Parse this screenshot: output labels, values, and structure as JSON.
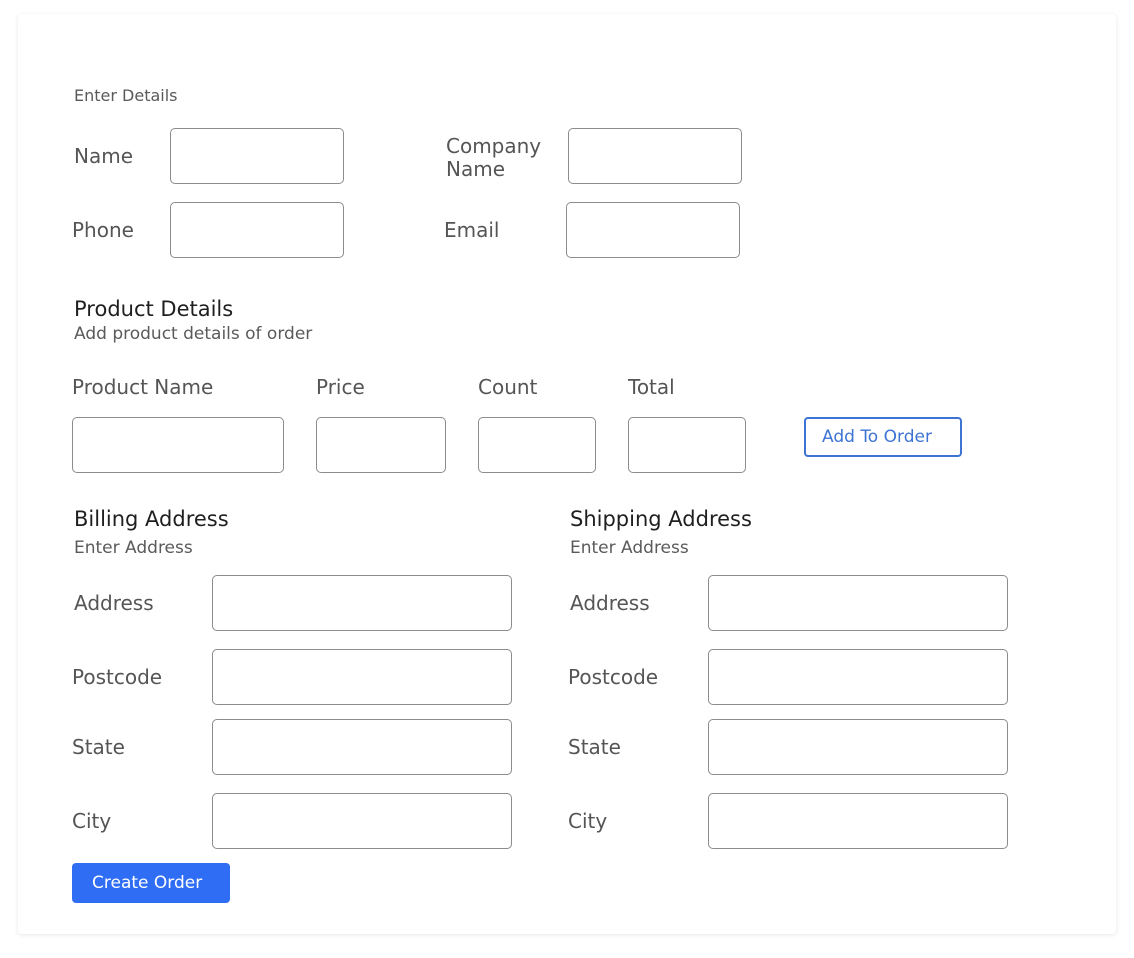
{
  "customer": {
    "heading": "Enter Details",
    "name_label": "Name",
    "company_label": "Company Name",
    "phone_label": "Phone",
    "email_label": "Email",
    "name_value": "",
    "company_value": "",
    "phone_value": "",
    "email_value": ""
  },
  "product": {
    "title": "Product Details",
    "subtitle": "Add product details of order",
    "name_label": "Product Name",
    "price_label": "Price",
    "count_label": "Count",
    "total_label": "Total",
    "add_button": "Add To Order"
  },
  "billing": {
    "title": "Billing Address",
    "subtitle": "Enter Address",
    "address_label": "Address",
    "postcode_label": "Postcode",
    "state_label": "State",
    "city_label": "City"
  },
  "shipping": {
    "title": "Shipping Address",
    "subtitle": "Enter Address",
    "address_label": "Address",
    "postcode_label": "Postcode",
    "state_label": "State",
    "city_label": "City"
  },
  "actions": {
    "create_button": "Create Order"
  },
  "colors": {
    "accent": "#2f6df5",
    "outline_button": "#3d74d4",
    "input_border": "#8c8c8c"
  }
}
